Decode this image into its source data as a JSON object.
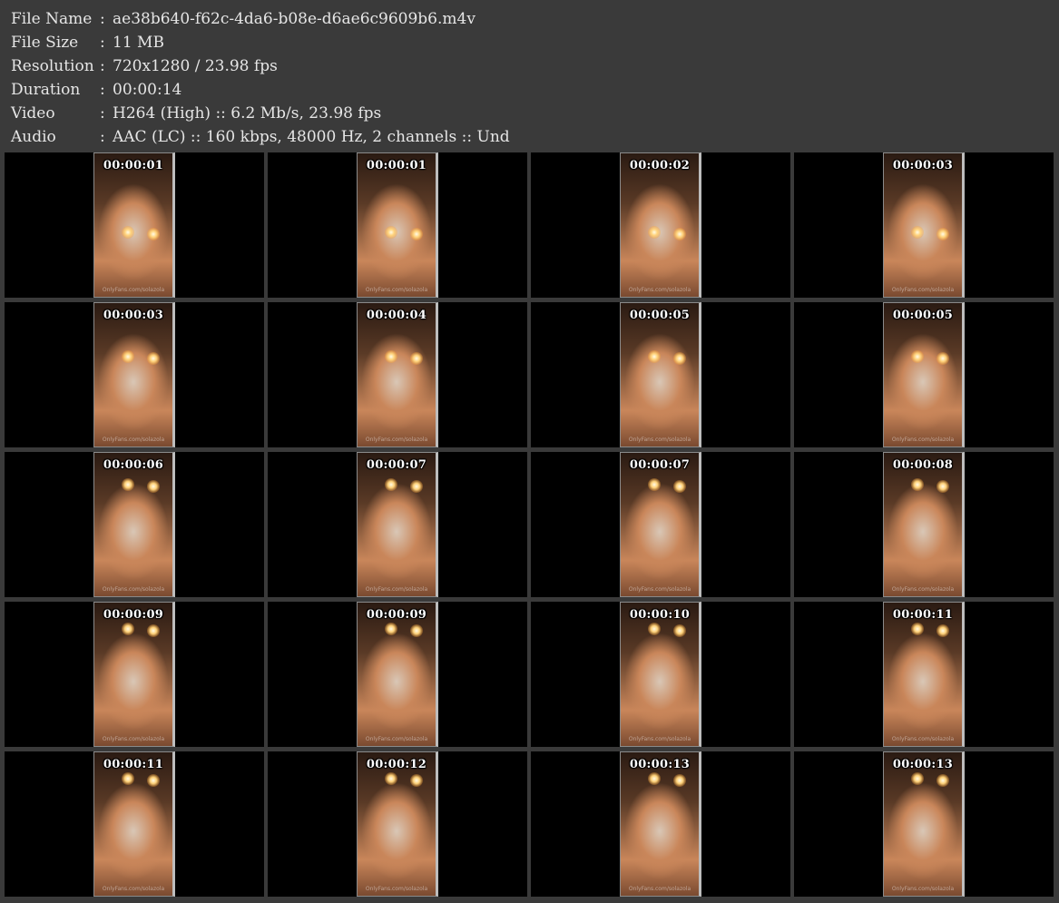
{
  "info": [
    {
      "label": "File Name",
      "sep": ":",
      "value": "ae38b640-f62c-4da6-b08e-d6ae6c9609b6.m4v"
    },
    {
      "label": "File Size",
      "sep": ":",
      "value": "11 MB"
    },
    {
      "label": "Resolution",
      "sep": ":",
      "value": "720x1280 / 23.98 fps"
    },
    {
      "label": "Duration",
      "sep": ":",
      "value": "00:00:14"
    },
    {
      "label": "Video",
      "sep": ":",
      "value": "H264 (High) :: 6.2 Mb/s, 23.98 fps"
    },
    {
      "label": "Audio",
      "sep": ":",
      "value": "AAC (LC) :: 160 kbps, 48000 Hz, 2 channels :: Und"
    }
  ],
  "thumbnails": [
    {
      "timestamp": "00:00:01",
      "watermark": "OnlyFans.com/solazola"
    },
    {
      "timestamp": "00:00:01",
      "watermark": "OnlyFans.com/solazola"
    },
    {
      "timestamp": "00:00:02",
      "watermark": "OnlyFans.com/solazola"
    },
    {
      "timestamp": "00:00:03",
      "watermark": "OnlyFans.com/solazola"
    },
    {
      "timestamp": "00:00:03",
      "watermark": "OnlyFans.com/solazola"
    },
    {
      "timestamp": "00:00:04",
      "watermark": "OnlyFans.com/solazola"
    },
    {
      "timestamp": "00:00:05",
      "watermark": "OnlyFans.com/solazola"
    },
    {
      "timestamp": "00:00:05",
      "watermark": "OnlyFans.com/solazola"
    },
    {
      "timestamp": "00:00:06",
      "watermark": "OnlyFans.com/solazola"
    },
    {
      "timestamp": "00:00:07",
      "watermark": "OnlyFans.com/solazola"
    },
    {
      "timestamp": "00:00:07",
      "watermark": "OnlyFans.com/solazola"
    },
    {
      "timestamp": "00:00:08",
      "watermark": "OnlyFans.com/solazola"
    },
    {
      "timestamp": "00:00:09",
      "watermark": "OnlyFans.com/solazola"
    },
    {
      "timestamp": "00:00:09",
      "watermark": "OnlyFans.com/solazola"
    },
    {
      "timestamp": "00:00:10",
      "watermark": "OnlyFans.com/solazola"
    },
    {
      "timestamp": "00:00:11",
      "watermark": "OnlyFans.com/solazola"
    },
    {
      "timestamp": "00:00:11",
      "watermark": "OnlyFans.com/solazola"
    },
    {
      "timestamp": "00:00:12",
      "watermark": "OnlyFans.com/solazola"
    },
    {
      "timestamp": "00:00:13",
      "watermark": "OnlyFans.com/solazola"
    },
    {
      "timestamp": "00:00:13",
      "watermark": "OnlyFans.com/solazola"
    }
  ],
  "colors": {
    "page_background": "#3a3a3a",
    "cell_background": "#000000",
    "info_text": "#e6e6e6",
    "timestamp_text": "#ffffff",
    "scene_warm": "#c9865a",
    "scene_dark": "#2a1a12"
  }
}
